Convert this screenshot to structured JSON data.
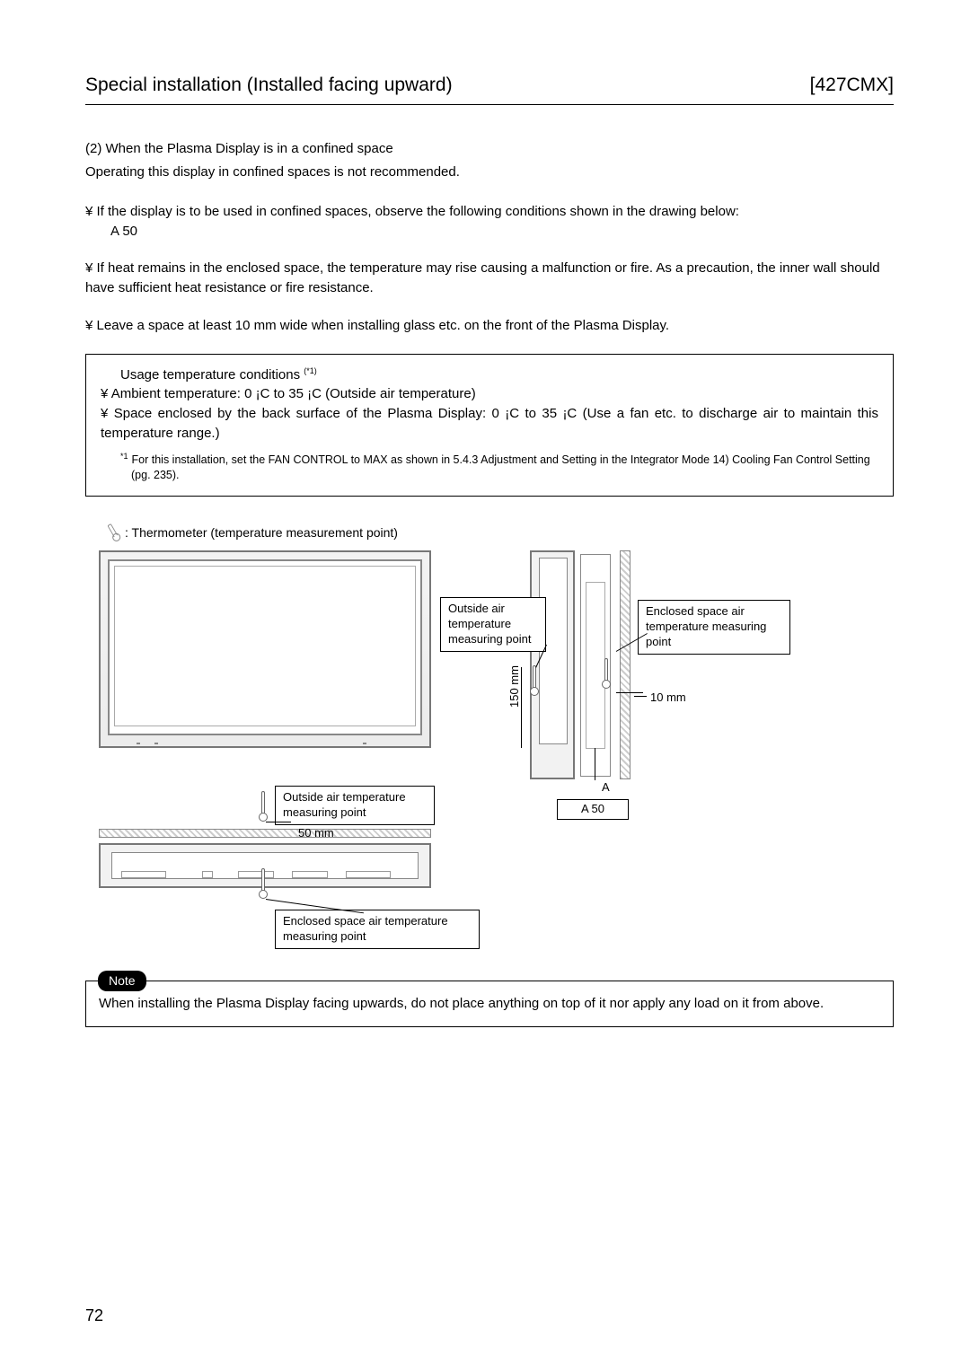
{
  "header": {
    "title": "Special installation (Installed facing upward)",
    "model": "[427CMX]"
  },
  "section": {
    "heading": "(2) When the Plasma Display is in a confined space",
    "intro": "Operating this display in confined spaces is not recommended."
  },
  "bullets": {
    "b1": "If the display is to be used in confined spaces, observe the following conditions shown in the drawing below:",
    "b1_sub": "A   50",
    "b2": "If heat remains in the enclosed space, the temperature may rise causing a malfunction or fire. As a precaution, the inner wall should have sufficient heat resistance or fire resistance.",
    "b3": "Leave a space at least 10 mm wide when installing glass etc. on the front of the Plasma Display."
  },
  "conditions": {
    "title": "Usage temperature conditions",
    "title_super": "(*1)",
    "c1": "Ambient temperature: 0 ¡C to 35 ¡C (Outside air temperature)",
    "c2": "Space enclosed by the back surface of the Plasma Display: 0 ¡C to 35 ¡C (Use a fan etc. to discharge air to maintain this temperature range.)",
    "footnote": "For this installation, set the  FAN CONTROL  to  MAX  as shown in  5.4.3 Adjustment and Setting in the Integrator Mode 14) Cooling Fan Control Setting  (pg. 235).",
    "fn_mark": "*1"
  },
  "legend": {
    "text": ": Thermometer (temperature measurement point)"
  },
  "diagram": {
    "label_outside_side": "Outside air temperature measuring point",
    "label_enclosed_side": "Enclosed space air temperature measuring point",
    "label_outside_bottom": "Outside air temperature measuring point",
    "label_enclosed_bottom": "Enclosed space air temperature measuring point",
    "dim_10mm": "10 mm",
    "dim_150mm": "150 mm",
    "dim_A": "A",
    "dim_A50": "A   50",
    "dim_50mm": "50 mm"
  },
  "note": {
    "label": "Note",
    "body": "When installing the Plasma Display facing upwards, do not place anything on top of it nor apply any load on it from above."
  },
  "page_number": "72"
}
